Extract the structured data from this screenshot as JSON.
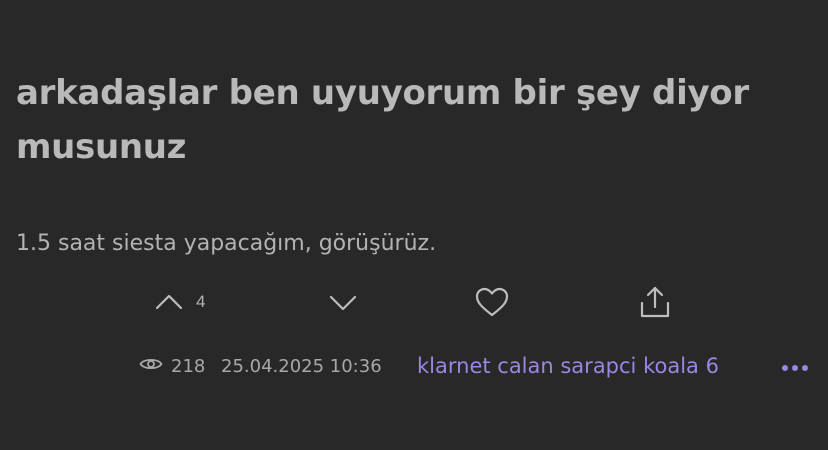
{
  "post": {
    "title": "arkadaşlar ben uyuyorum bir şey diyor musunuz",
    "body": "1.5 saat siesta yapacağım, görüşürüz."
  },
  "actions": {
    "upvote_count": "4",
    "icons": {
      "upvote": "chevron-up-icon",
      "downvote": "chevron-down-icon",
      "like": "heart-icon",
      "share": "share-icon"
    }
  },
  "meta": {
    "views": "218",
    "date": "25.04.2025 10:36",
    "author": "klarnet calan sarapci koala 6",
    "more_icon": "more-dots-icon"
  },
  "colors": {
    "background": "#282828",
    "text": "#bdbdbd",
    "accent": "#9b86e0"
  }
}
